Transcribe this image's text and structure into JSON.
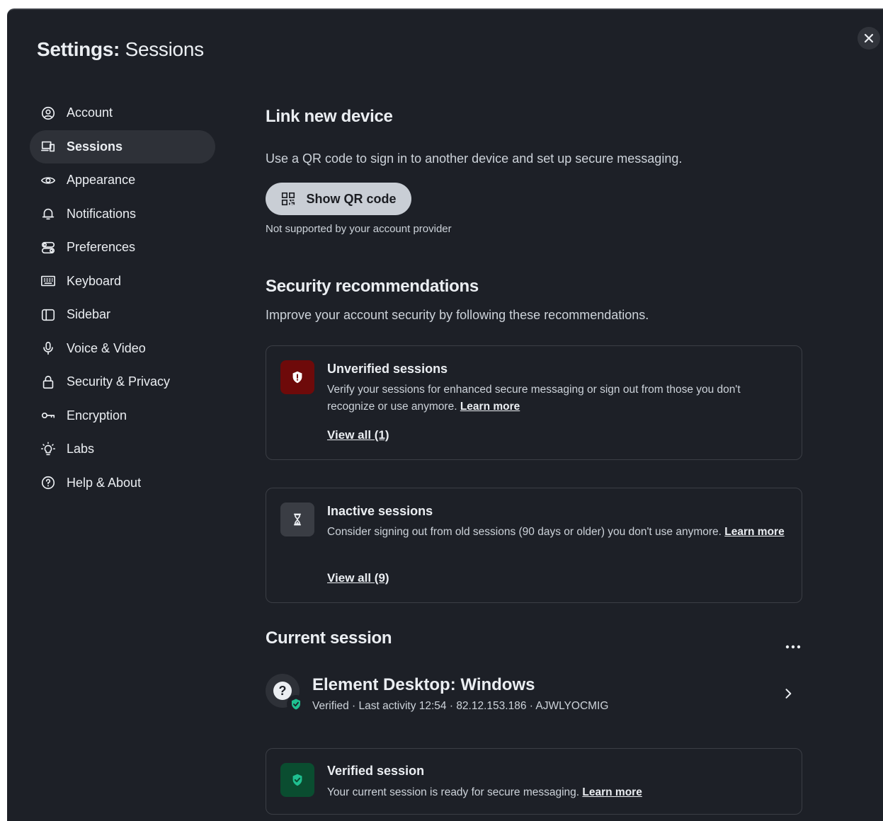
{
  "window": {
    "title_prefix": "Settings:",
    "title_section": "Sessions"
  },
  "sidebar": {
    "items": [
      {
        "label": "Account",
        "icon": "user-circle-icon",
        "active": false
      },
      {
        "label": "Sessions",
        "icon": "devices-icon",
        "active": true
      },
      {
        "label": "Appearance",
        "icon": "eye-icon",
        "active": false
      },
      {
        "label": "Notifications",
        "icon": "bell-icon",
        "active": false
      },
      {
        "label": "Preferences",
        "icon": "preferences-icon",
        "active": false
      },
      {
        "label": "Keyboard",
        "icon": "keyboard-icon",
        "active": false
      },
      {
        "label": "Sidebar",
        "icon": "sidebar-icon",
        "active": false
      },
      {
        "label": "Voice & Video",
        "icon": "microphone-icon",
        "active": false
      },
      {
        "label": "Security & Privacy",
        "icon": "lock-icon",
        "active": false
      },
      {
        "label": "Encryption",
        "icon": "key-icon",
        "active": false
      },
      {
        "label": "Labs",
        "icon": "lightbulb-icon",
        "active": false
      },
      {
        "label": "Help & About",
        "icon": "help-icon",
        "active": false
      }
    ]
  },
  "link_device": {
    "heading": "Link new device",
    "description": "Use a QR code to sign in to another device and set up secure messaging.",
    "button_label": "Show QR code",
    "note": "Not supported by your account provider"
  },
  "security": {
    "heading": "Security recommendations",
    "description": "Improve your account security by following these recommendations.",
    "unverified": {
      "title": "Unverified sessions",
      "body": "Verify your sessions for enhanced secure messaging or sign out from those you don't recognize or use anymore.",
      "learn_more": "Learn more",
      "view_all": "View all (1)"
    },
    "inactive": {
      "title": "Inactive sessions",
      "body": "Consider signing out from old sessions (90 days or older) you don't use anymore.",
      "learn_more": "Learn more",
      "view_all": "View all (9)"
    }
  },
  "current_session": {
    "heading": "Current session",
    "device_name": "Element Desktop: Windows",
    "meta": "Verified · Last activity 12:54 · 82.12.153.186 · AJWLYOCMIG",
    "verified_card": {
      "title": "Verified session",
      "body": "Your current session is ready for secure messaging.",
      "learn_more": "Learn more"
    }
  },
  "colors": {
    "background": "#1d2027",
    "danger_badge": "#6e0a0a",
    "success_badge": "#0a4d30",
    "success_icon": "#1fc090",
    "active_nav": "#2e3138"
  }
}
